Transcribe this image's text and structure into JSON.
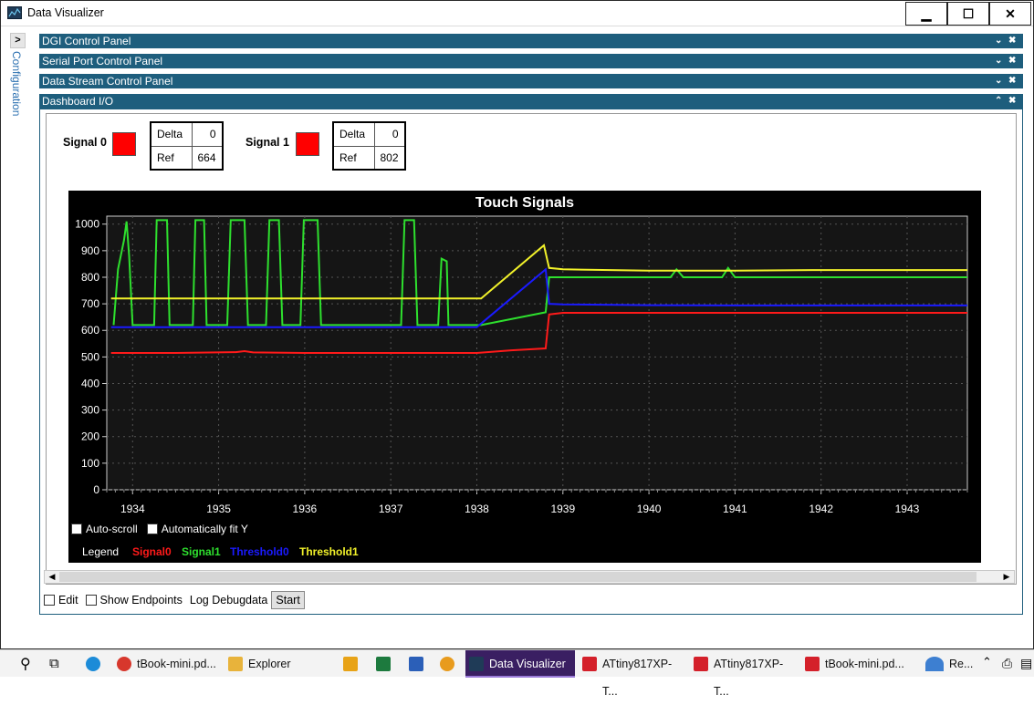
{
  "window": {
    "title": "Data Visualizer",
    "minimize": "▁",
    "maximize": "☐",
    "close": "✕"
  },
  "sidebar": {
    "toggle": ">",
    "label": "Configuration"
  },
  "panels": [
    {
      "label": "DGI Control Panel"
    },
    {
      "label": "Serial Port Control Panel"
    },
    {
      "label": "Data Stream Control Panel"
    },
    {
      "label": "Dashboard I/O"
    }
  ],
  "panel_ctrls": {
    "collapse": "⌄",
    "expand": "⌃",
    "close": "✖"
  },
  "signals": [
    {
      "label": "Signal 0",
      "delta_label": "Delta",
      "delta": "0",
      "ref_label": "Ref",
      "ref": "664",
      "color": "#ff0000"
    },
    {
      "label": "Signal 1",
      "delta_label": "Delta",
      "delta": "0",
      "ref_label": "Ref",
      "ref": "802",
      "color": "#ff0000"
    }
  ],
  "chart_options": {
    "auto_scroll": "Auto-scroll",
    "auto_fit": "Automatically fit Y"
  },
  "legend": {
    "title": "Legend"
  },
  "bottom": {
    "edit": "Edit",
    "show_endpoints": "Show Endpoints",
    "log": "Log Debugdata",
    "start": "Start"
  },
  "taskbar": {
    "items": [
      {
        "label": "tBook-mini.pd...",
        "icon_color": "#d7372c"
      },
      {
        "label": "Explorer",
        "icon_color": "#e8b33b"
      },
      {
        "label": "Data Visualizer",
        "icon_color": "#1f3b57"
      },
      {
        "label": "ATtiny817XP-T...",
        "icon_color": "#d4202a"
      },
      {
        "label": "ATtiny817XP-T...",
        "icon_color": "#d4202a"
      },
      {
        "label": "tBook-mini.pd...",
        "icon_color": "#d4202a"
      },
      {
        "label": "Re...",
        "icon_color": "#3d7fd1"
      }
    ]
  },
  "chart_data": {
    "type": "line",
    "title": "Touch Signals",
    "xlim": [
      1933.7,
      1943.7
    ],
    "ylim": [
      0,
      1030
    ],
    "xticks": [
      1934,
      1935,
      1936,
      1937,
      1938,
      1939,
      1940,
      1941,
      1942,
      1943
    ],
    "yticks": [
      0,
      100,
      200,
      300,
      400,
      500,
      600,
      700,
      800,
      900,
      1000
    ],
    "grid": true,
    "legend_position": "bottom",
    "series": [
      {
        "name": "Signal0",
        "color": "#ff1a1a",
        "points": [
          [
            1933.75,
            515
          ],
          [
            1934.5,
            515
          ],
          [
            1935.2,
            518
          ],
          [
            1935.3,
            522
          ],
          [
            1935.4,
            517
          ],
          [
            1936,
            515
          ],
          [
            1937,
            515
          ],
          [
            1938,
            515
          ],
          [
            1938.4,
            525
          ],
          [
            1938.8,
            532
          ],
          [
            1938.84,
            660
          ],
          [
            1939,
            666
          ],
          [
            1940,
            666
          ],
          [
            1941,
            666
          ],
          [
            1942,
            666
          ],
          [
            1943,
            666
          ],
          [
            1943.7,
            666
          ]
        ]
      },
      {
        "name": "Signal1",
        "color": "#2ee02e",
        "points": [
          [
            1933.78,
            620
          ],
          [
            1933.83,
            830
          ],
          [
            1933.9,
            940
          ],
          [
            1933.93,
            1010
          ],
          [
            1933.96,
            880
          ],
          [
            1934,
            620
          ],
          [
            1934.25,
            620
          ],
          [
            1934.28,
            1015
          ],
          [
            1934.4,
            1015
          ],
          [
            1934.43,
            620
          ],
          [
            1934.7,
            620
          ],
          [
            1934.73,
            1015
          ],
          [
            1934.83,
            1015
          ],
          [
            1934.86,
            620
          ],
          [
            1935.1,
            620
          ],
          [
            1935.14,
            1015
          ],
          [
            1935.3,
            1015
          ],
          [
            1935.34,
            620
          ],
          [
            1935.55,
            620
          ],
          [
            1935.59,
            1015
          ],
          [
            1935.7,
            1015
          ],
          [
            1935.74,
            620
          ],
          [
            1935.95,
            620
          ],
          [
            1935.99,
            1015
          ],
          [
            1936.15,
            1015
          ],
          [
            1936.19,
            620
          ],
          [
            1937.12,
            620
          ],
          [
            1937.16,
            1015
          ],
          [
            1937.27,
            1015
          ],
          [
            1937.31,
            620
          ],
          [
            1937.55,
            620
          ],
          [
            1937.59,
            870
          ],
          [
            1937.65,
            860
          ],
          [
            1937.67,
            620
          ],
          [
            1938.05,
            620
          ],
          [
            1938.8,
            668
          ],
          [
            1938.84,
            800
          ],
          [
            1940,
            800
          ],
          [
            1940.25,
            800
          ],
          [
            1940.32,
            830
          ],
          [
            1940.4,
            800
          ],
          [
            1940.85,
            800
          ],
          [
            1940.92,
            835
          ],
          [
            1941,
            800
          ],
          [
            1942,
            800
          ],
          [
            1943,
            800
          ],
          [
            1943.7,
            800
          ]
        ]
      },
      {
        "name": "Threshold0",
        "color": "#1a1aff",
        "points": [
          [
            1933.75,
            612
          ],
          [
            1938,
            612
          ],
          [
            1938.8,
            830
          ],
          [
            1938.84,
            700
          ],
          [
            1939,
            698
          ],
          [
            1940,
            695
          ],
          [
            1941,
            694
          ],
          [
            1942,
            694
          ],
          [
            1943,
            694
          ],
          [
            1943.7,
            694
          ]
        ]
      },
      {
        "name": "Threshold1",
        "color": "#f2f22a",
        "points": [
          [
            1933.75,
            720
          ],
          [
            1938.05,
            720
          ],
          [
            1938.78,
            920
          ],
          [
            1938.84,
            835
          ],
          [
            1939,
            830
          ],
          [
            1940,
            825
          ],
          [
            1941,
            825
          ],
          [
            1942,
            827
          ],
          [
            1943,
            827
          ],
          [
            1943.7,
            827
          ]
        ]
      }
    ]
  }
}
